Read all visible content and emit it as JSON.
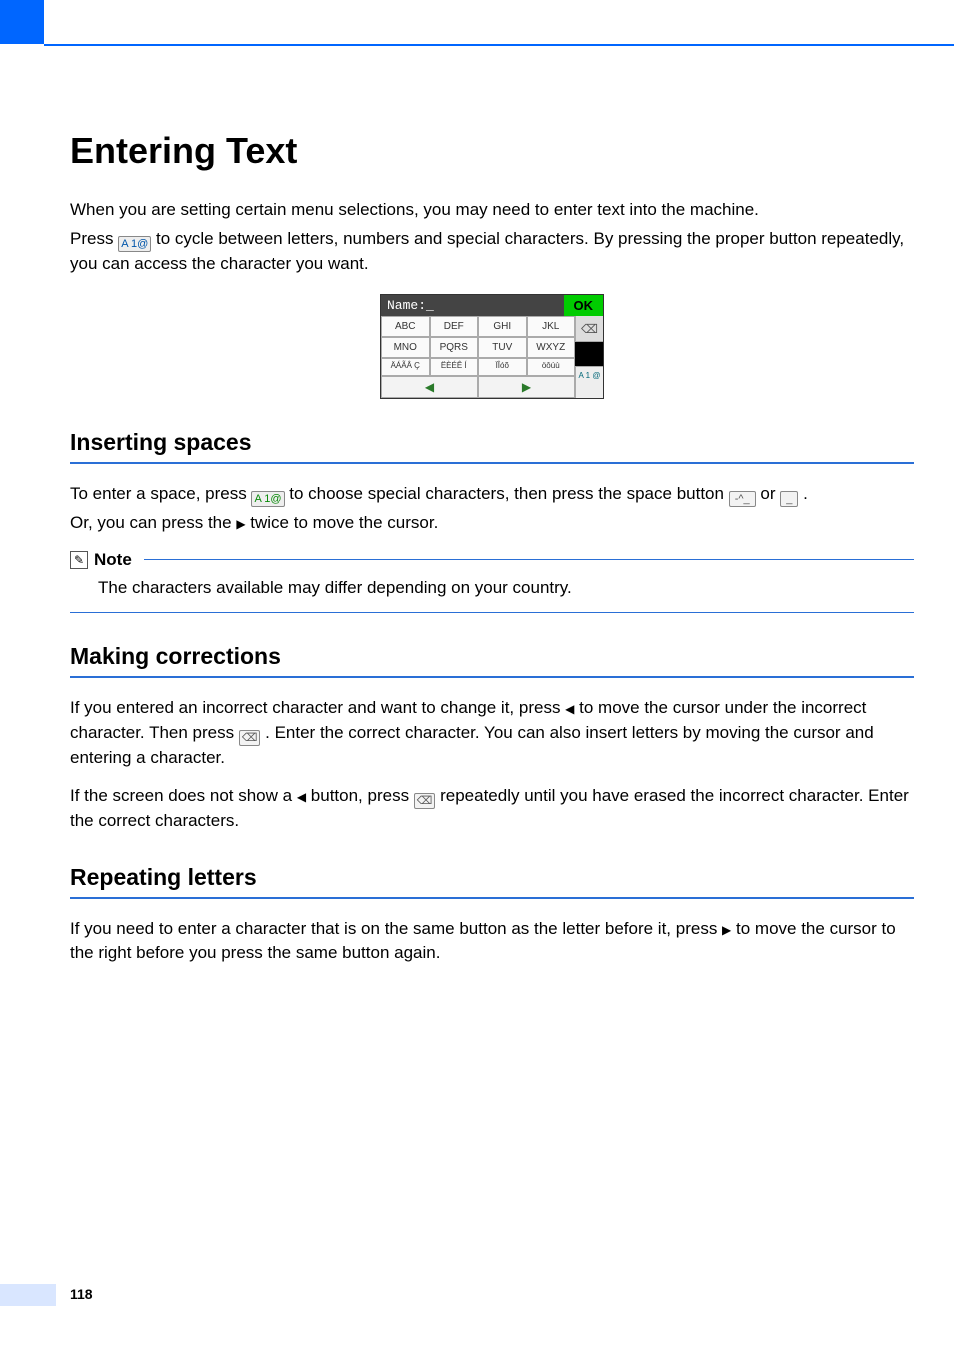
{
  "page_number": "118",
  "title": "Entering Text",
  "intro": {
    "line1": "When you are setting certain menu selections, you may need to enter text into the machine.",
    "line2a": "Press ",
    "line2b": " to cycle between letters, numbers and special characters. By pressing the proper button repeatedly, you can access the character you want."
  },
  "keypad": {
    "name_label": "Name:_",
    "ok": "OK",
    "rows": [
      [
        "ABC",
        "DEF",
        "GHI",
        "JKL"
      ],
      [
        "MNO",
        "PQRS",
        "TUV",
        "WXYZ"
      ]
    ],
    "accent_row": [
      "ÄÁÃÂ Ç",
      "ËÈÉÊ Í",
      "ÏÎóõ",
      "öôúù"
    ],
    "nav_left": "◀",
    "nav_right": "▶",
    "backspace": "⌫",
    "mode": "A 1 @"
  },
  "sections": {
    "inserting": {
      "heading": "Inserting spaces",
      "p1a": "To enter a space, press ",
      "p1b": " to choose special characters, then press the space button ",
      "p1c": " or ",
      "p1d": ".",
      "p2a": "Or, you can press the ",
      "p2b": " twice to move the cursor.",
      "note_label": "Note",
      "note_text": "The characters available may differ depending on your country."
    },
    "corrections": {
      "heading": "Making corrections",
      "p1a": "If you entered an incorrect character and want to change it, press ",
      "p1b": " to move the cursor under the incorrect character. Then press ",
      "p1c": ". Enter the correct character. You can also insert letters by moving the cursor and entering a character.",
      "p2a": "If the screen does not show a ",
      "p2b": " button, press ",
      "p2c": " repeatedly until you have erased the incorrect character. Enter the correct characters."
    },
    "repeating": {
      "heading": "Repeating letters",
      "p1a": "If you need to enter a character that is on the same button as the letter before it, press ",
      "p1b": " to move the cursor to the right before you press the same button again."
    }
  },
  "icons": {
    "mode_key": "A 1@",
    "space1": "-^_",
    "space2": "_",
    "backspace": "⌫"
  }
}
